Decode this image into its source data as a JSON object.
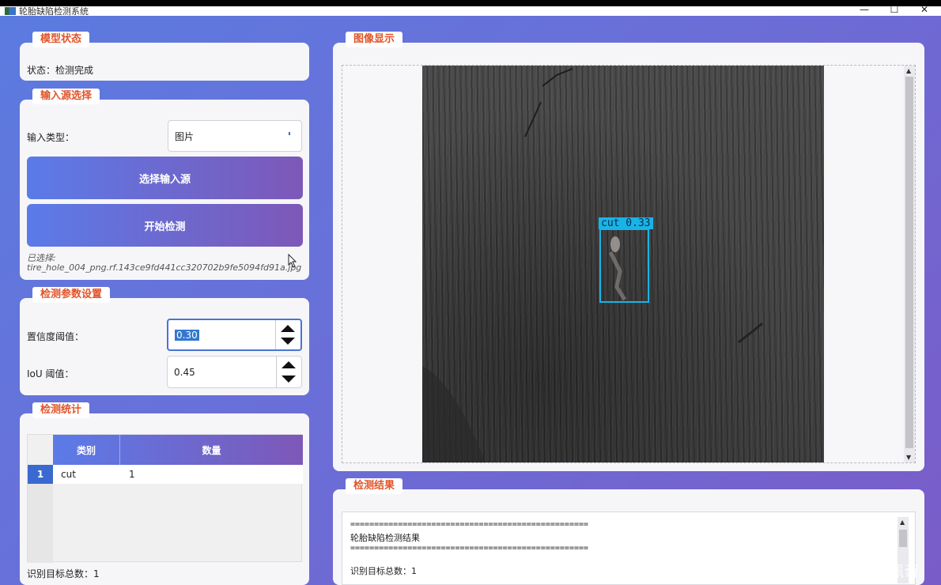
{
  "window": {
    "title": "轮胎缺陷检测系统",
    "minimize": "—",
    "maximize": "☐",
    "close": "✕"
  },
  "model_status": {
    "tag": "模型状态",
    "status": "状态：检测完成"
  },
  "input_source": {
    "tag": "输入源选择",
    "type_label": "输入类型：",
    "type_value": "图片",
    "select_button": "选择输入源",
    "start_button": "开始检测",
    "selected_label": "已选择:",
    "selected_file": "tire_hole_004_png.rf.143ce9fd441cc320702b9fe5094fd91a.jpg"
  },
  "params": {
    "tag": "检测参数设置",
    "conf_label": "置信度阈值：",
    "conf_value": "0.30",
    "iou_label": "IoU 阈值：",
    "iou_value": "0.45"
  },
  "stats": {
    "tag": "检测统计",
    "columns": [
      "类别",
      "数量"
    ],
    "rows": [
      {
        "index": "1",
        "category": "cut",
        "count": "1"
      }
    ],
    "total": "识别目标总数：1"
  },
  "image_display": {
    "tag": "图像显示",
    "detection_label": "cut  0.33",
    "box_color": "#19b4e6"
  },
  "results": {
    "tag": "检测结果",
    "separator": "==================================================",
    "title": "轮胎缺陷检测结果",
    "total": "识别目标总数：1"
  },
  "watermark": "CSDN @飞翔的佩奇"
}
